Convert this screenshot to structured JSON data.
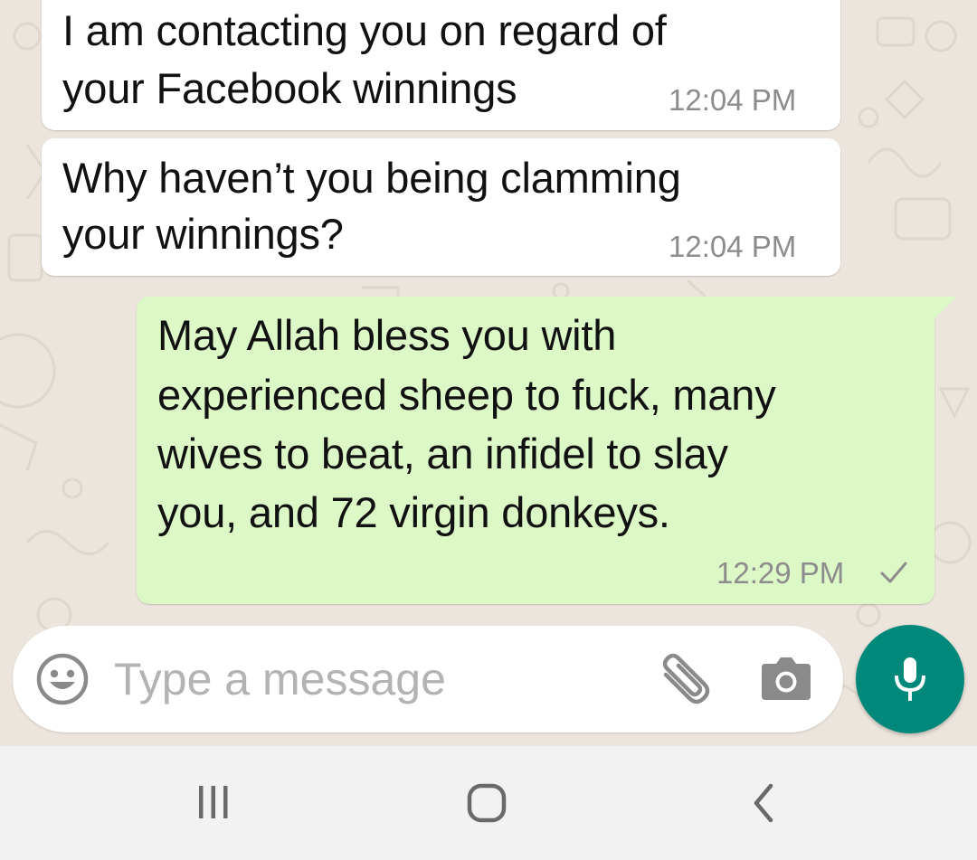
{
  "messages": [
    {
      "direction": "incoming",
      "lines": [
        "I am contacting you on regard of",
        "your Facebook winnings"
      ],
      "time": "12:04 PM"
    },
    {
      "direction": "incoming",
      "lines": [
        "Why haven’t you being clamming",
        "your winnings?"
      ],
      "time": "12:04 PM"
    },
    {
      "direction": "outgoing",
      "lines": [
        "May Allah bless you with",
        "experienced sheep to fuck, many",
        "wives to beat, an infidel to slay",
        "you, and 72 virgin donkeys."
      ],
      "time": "12:29 PM",
      "status_icon": "single-check-icon"
    }
  ],
  "composer": {
    "placeholder": "Type a message",
    "value": "",
    "emoji_icon": "emoji-icon",
    "attach_icon": "paperclip-icon",
    "camera_icon": "camera-icon",
    "mic_icon": "microphone-icon"
  },
  "navigation": {
    "recents_icon": "recents-icon",
    "home_icon": "home-icon",
    "back_icon": "back-icon"
  },
  "colors": {
    "chat_background": "#ece5dd",
    "incoming_bubble": "#ffffff",
    "outgoing_bubble": "#dcf8c6",
    "accent": "#00897b",
    "timestamp": "#8c8c8c",
    "nav_bar": "#f2f2f2"
  }
}
